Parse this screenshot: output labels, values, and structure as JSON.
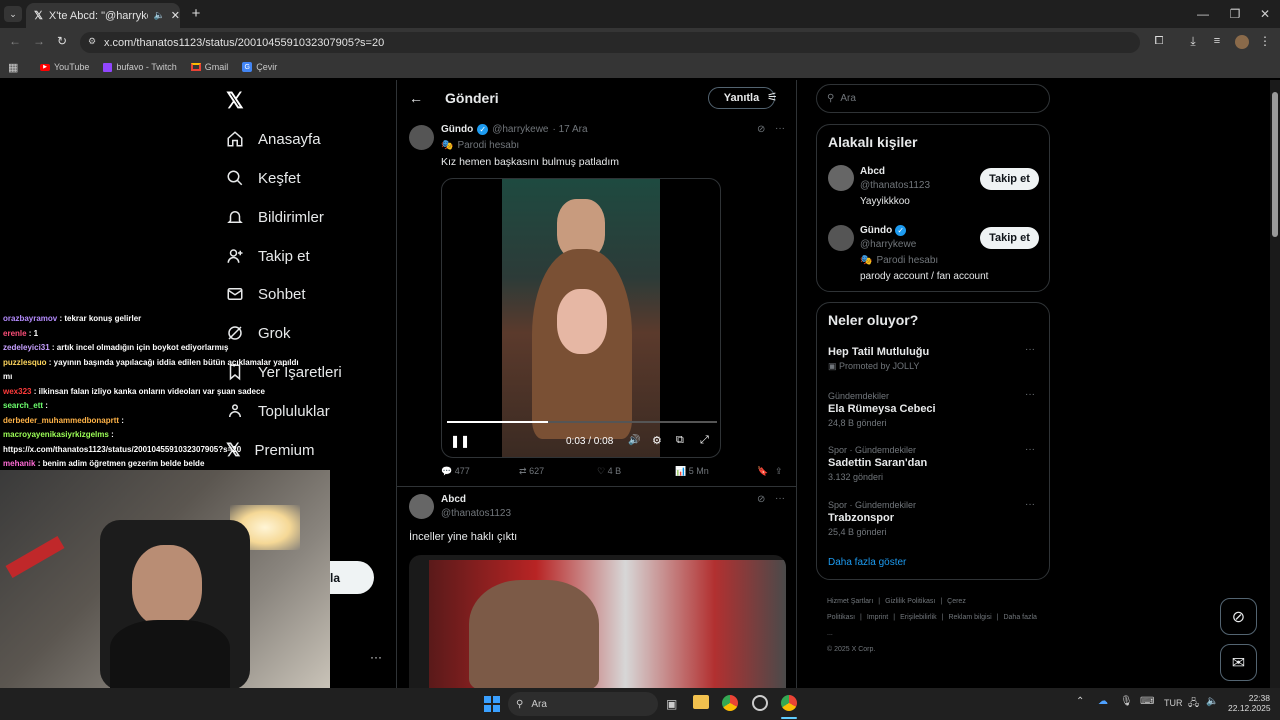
{
  "browser": {
    "tab_title": "X'te Abcd: \"@harrykewe İnc",
    "url": "x.com/thanatos1123/status/2001045591032307905?s=20",
    "bookmarks": [
      {
        "label": "YouTube",
        "icon": "youtube-icon"
      },
      {
        "label": "bufavo - Twitch",
        "icon": "twitch-icon"
      },
      {
        "label": "Gmail",
        "icon": "gmail-icon"
      },
      {
        "label": "Çevir",
        "icon": "translate-icon"
      }
    ]
  },
  "nav": {
    "items": [
      "Anasayfa",
      "Keşfet",
      "Bildirimler",
      "Takip et",
      "Sohbet",
      "Grok",
      "Yer İşaretleri",
      "Topluluklar",
      "Premium"
    ],
    "post_button_partial": "la"
  },
  "post_header": {
    "title": "Gönderi",
    "reply_button": "Yanıtla"
  },
  "tweet1": {
    "name": "Gündo",
    "handle": "@harrykewe",
    "date": "· 17 Ara",
    "label": "Parodi hesabı",
    "text": "Kız hemen başkasını bulmuş patladım",
    "video_time": "0:03 / 0:08",
    "video_progress": 0.375,
    "stats": {
      "replies": "477",
      "reposts": "627",
      "likes": "4 B",
      "views": "5 Mn"
    }
  },
  "tweet2": {
    "name": "Abcd",
    "handle": "@thanatos1123",
    "text": "İnceller yine haklı çıktı"
  },
  "search": {
    "placeholder": "Ara"
  },
  "relevant": {
    "title": "Alakalı kişiler",
    "people": [
      {
        "name": "Abcd",
        "handle": "@thanatos1123",
        "bio": "Yayyikkkoo",
        "button": "Takip et",
        "verified": false,
        "label": ""
      },
      {
        "name": "Gündo",
        "handle": "@harrykewe",
        "bio": "parody account / fan account",
        "button": "Takip et",
        "verified": true,
        "label": "Parodi hesabı"
      }
    ]
  },
  "trends": {
    "title": "Neler oluyor?",
    "items": [
      {
        "category": "",
        "name": "Hep Tatil Mutluluğu",
        "count": "Promoted by JOLLY"
      },
      {
        "category": "Gündemdekiler",
        "name": "Ela Rümeysa Cebeci",
        "count": "24,8 B gönderi"
      },
      {
        "category": "Spor · Gündemdekiler",
        "name": "Sadettin Saran'dan",
        "count": "3.132 gönderi"
      },
      {
        "category": "Spor · Gündemdekiler",
        "name": "Trabzonspor",
        "count": "25,4 B gönderi"
      }
    ],
    "show_more": "Daha fazla göster"
  },
  "footer": {
    "links": [
      "Hizmet Şartları",
      "|",
      "Gizlilik Politikası",
      "|",
      "Çerez Politikası",
      "|",
      "Imprint",
      "|",
      "Erişilebilirlik",
      "|",
      "Reklam bilgisi",
      "|",
      "Daha fazla ..."
    ],
    "copyright": "© 2025 X Corp."
  },
  "chat": [
    {
      "user": "orazbayramov",
      "msg": ": tekrar konuş gelirler",
      "color": "#b58cff"
    },
    {
      "user": "erenle",
      "msg": ": 1",
      "color": "#ff4f7a"
    },
    {
      "user": "zedeleyici31",
      "msg": ": artık incel olmadığın için boykot ediyorlarmış",
      "color": "#c7a0ff"
    },
    {
      "user": "puzzlesquo",
      "msg": ": yayının başında yapılacağı iddia edilen bütün açıklamalar yapıldı",
      "color": "#ffd75e"
    },
    {
      "user": "",
      "msg": "mı",
      "color": "#ffffff"
    },
    {
      "user": "wex323",
      "msg": ": ilkinsan falan izliyo kanka onların videoları var şuan sadece",
      "color": "#ff3b3b"
    },
    {
      "user": "search_ett",
      "msg": ":",
      "color": "#6dff6d"
    },
    {
      "user": "derbeder_muhammedbonaprtt",
      "msg": ":",
      "color": "#ffb347"
    },
    {
      "user": "macroyayenikasiyrkizgelms",
      "msg": ":",
      "color": "#9cff57"
    },
    {
      "user": "",
      "msg": "https://x.com/thanatos1123/status/2001045591032307905?s=20",
      "color": "#ffffff"
    },
    {
      "user": "mehanik",
      "msg": ": benim adim öğretmen gezerim belde belde",
      "color": "#ff6bd6"
    }
  ],
  "taskbar": {
    "search": "Ara",
    "lang": "TUR",
    "time": "22:38",
    "date": "22.12.2025"
  }
}
